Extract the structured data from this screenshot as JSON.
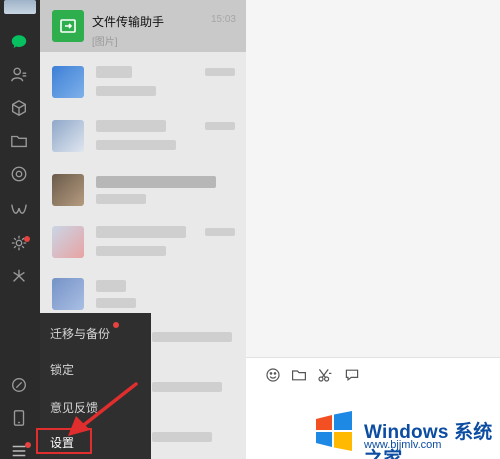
{
  "chat_list": {
    "first_item": {
      "name": "文件传输助手",
      "preview": "[图片]",
      "time": "15:03"
    }
  },
  "menu": {
    "items": [
      "迁移与备份",
      "锁定",
      "意见反馈",
      "设置"
    ]
  },
  "nav": {
    "icons": [
      "chat-icon",
      "contacts-icon",
      "cube-icon",
      "folder-icon",
      "moments-icon",
      "channels-icon",
      "miniprogram-icon",
      "search-icon",
      "phone-icon",
      "menu-icon",
      "link-icon"
    ]
  },
  "editor_toolbar": {
    "icons": [
      "emoji-icon",
      "folder-icon",
      "scissors-icon",
      "chat-bubble-icon"
    ]
  },
  "watermark": {
    "title": "Windows 系统之家",
    "url": "www.bjjmlv.com"
  },
  "colors": {
    "nav_bg": "#2b2b2b",
    "accent_green": "#07c160",
    "highlight_red": "#e02d2d",
    "watermark_blue": "#0c4da2"
  }
}
